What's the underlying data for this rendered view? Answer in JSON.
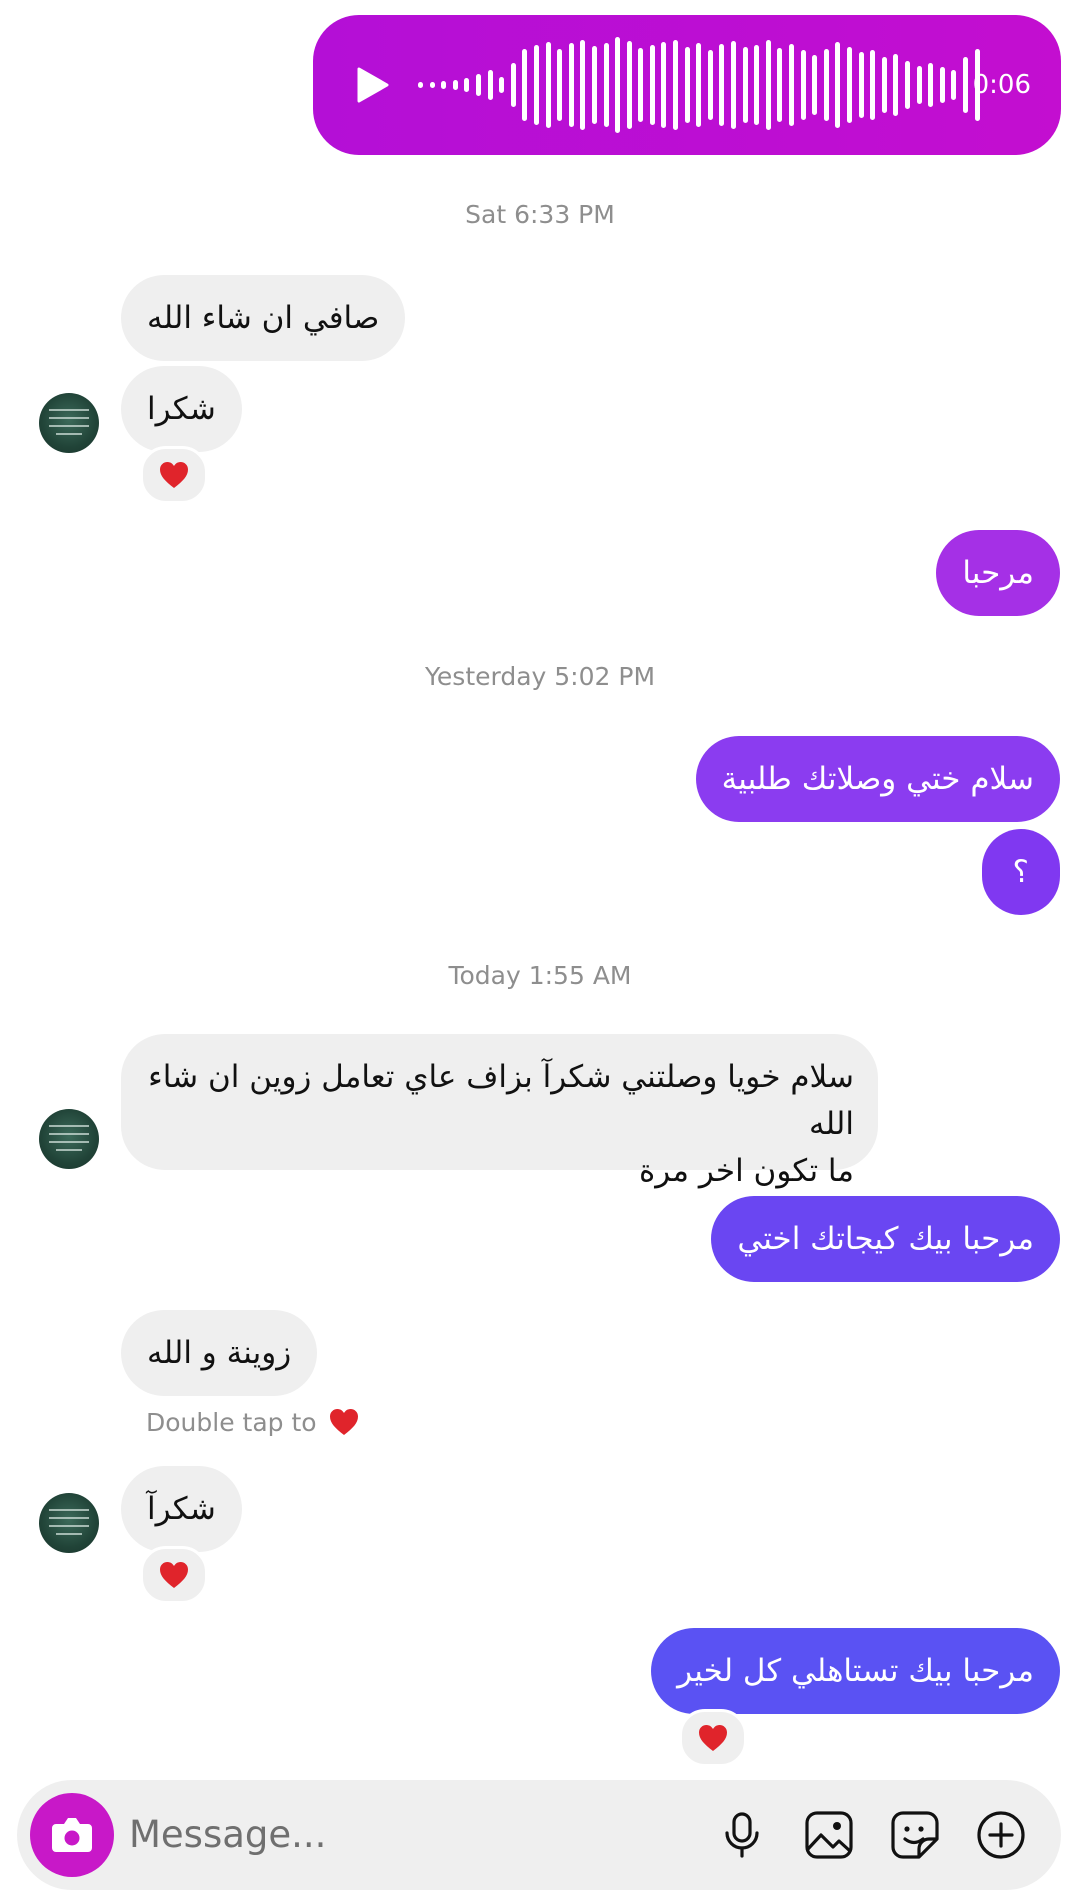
{
  "voice_note": {
    "duration": "0:06"
  },
  "timestamps": {
    "t1": "Sat 6:33 PM",
    "t2": "Yesterday 5:02 PM",
    "t3": "Today 1:55 AM"
  },
  "messages": {
    "m1": "صافي ان شاء الله",
    "m2": "شكرا",
    "m3": "مرحبا",
    "m4": "سلام ختي وصلاتك طلبية",
    "m5": "؟",
    "m6_line1": "سلام خويا وصلتني شكرآ بزاف عاي تعامل زوين ان شاء الله",
    "m6_line2": "ما تكون اخر مرة",
    "m7": "مرحبا بيك كيجاتك اختي",
    "m8": "زوينة و الله",
    "m9": "شكرآ",
    "m10": "مرحبا بيك تستاهلي كل لخير"
  },
  "hint": {
    "text": "Double tap to"
  },
  "composer": {
    "placeholder": "Message..."
  },
  "colors": {
    "voice": "#c010d2",
    "out_1": "#a530e6",
    "out_2": "#8b3cf0",
    "out_3": "#6a46f2",
    "out_4": "#5a52f3",
    "incoming": "#efefef",
    "heart": "#e0242b"
  },
  "icons": [
    "play-icon",
    "heart-icon",
    "camera-icon",
    "microphone-icon",
    "gallery-icon",
    "sticker-icon",
    "plus-icon"
  ]
}
